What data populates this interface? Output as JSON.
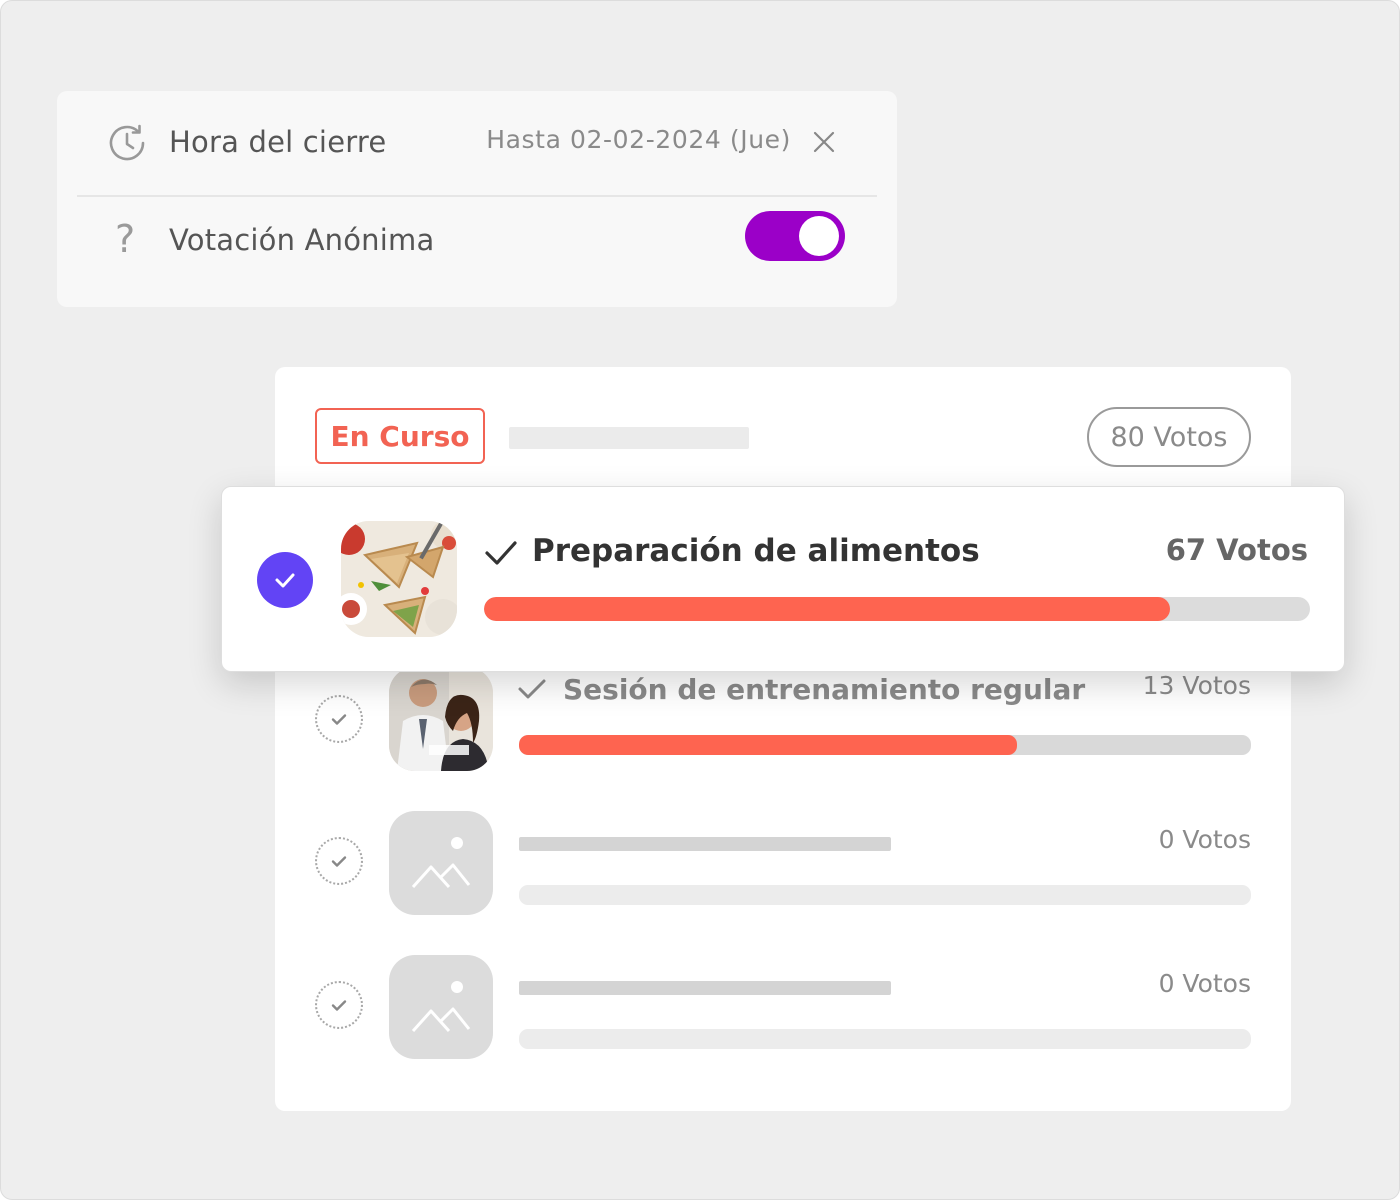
{
  "settings": {
    "closing_time": {
      "label": "Hora del cierre",
      "value": "Hasta 02-02-2024 (Jue)",
      "icon": "clock-history-icon",
      "clear_icon": "close-icon"
    },
    "anonymous_vote": {
      "label": "Votación Anónima",
      "help_glyph": "?",
      "enabled": true,
      "toggle_color": "#9b00c8"
    }
  },
  "poll": {
    "status": "En Curso",
    "status_color": "#f26353",
    "total_votes": "80 Votos",
    "options": [
      {
        "name": "Preparación de alimentos",
        "votes": "67 Votos",
        "fill": 0.83,
        "selected": true,
        "thumb": "food-photo"
      },
      {
        "name": "Sesión de entrenamiento regular",
        "votes": "13 Votos",
        "fill": 0.68,
        "selected": false,
        "thumb": "training-photo"
      },
      {
        "name": "",
        "votes": "0 Votos",
        "fill": 0,
        "selected": false,
        "thumb": "image-placeholder-icon"
      },
      {
        "name": "",
        "votes": "0 Votos",
        "fill": 0,
        "selected": false,
        "thumb": "image-placeholder-icon"
      }
    ],
    "bar_color": "#fe6450",
    "selected_radio_color": "#6244f5"
  }
}
